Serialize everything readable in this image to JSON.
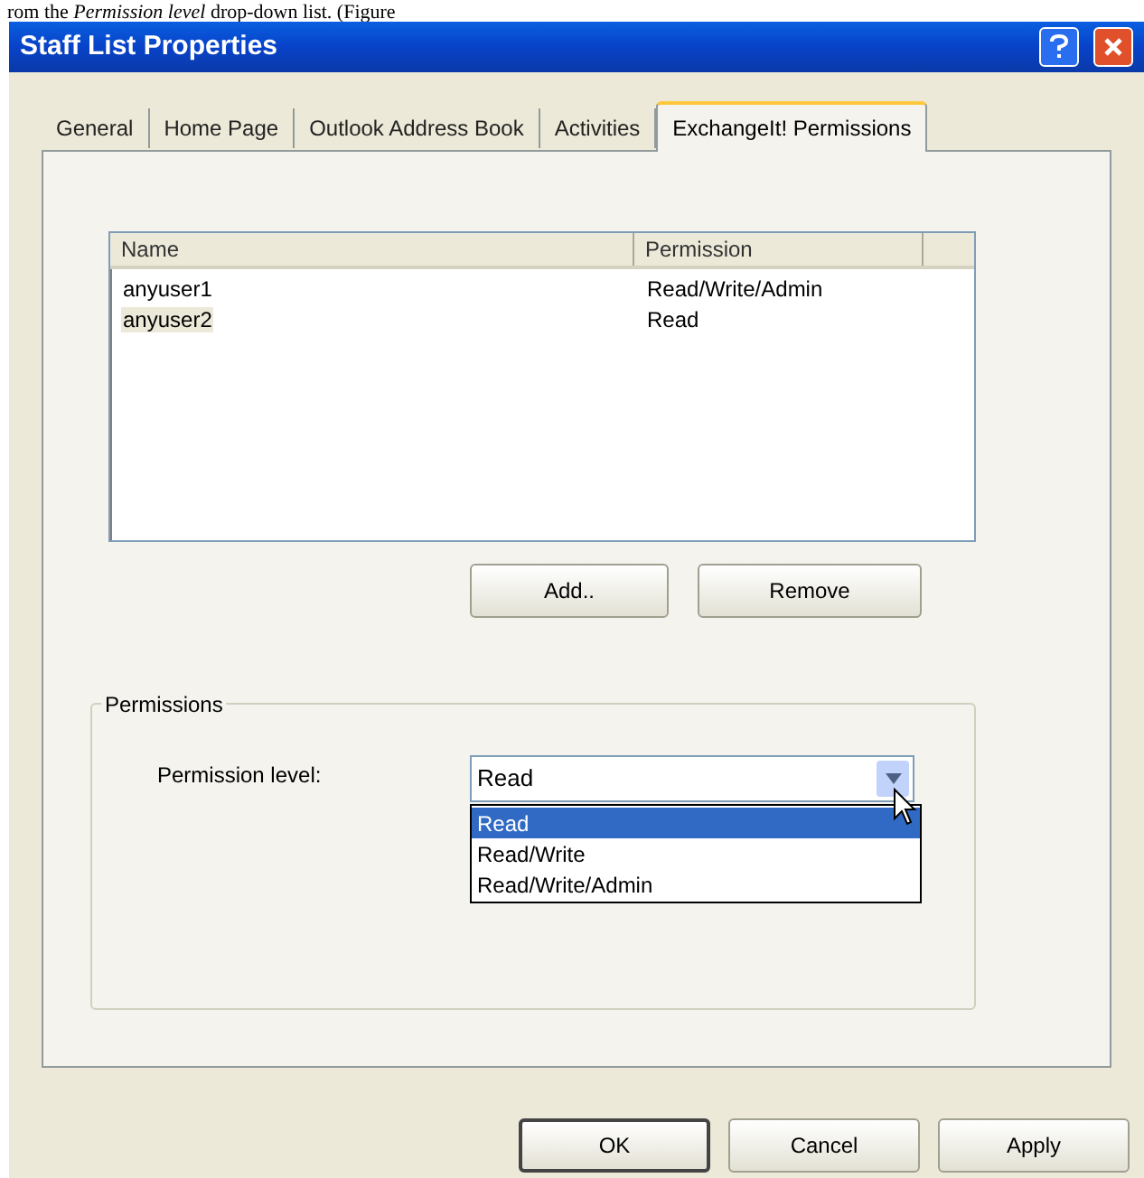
{
  "caption": "rom the *Permission level* drop-down list. (Figure",
  "window": {
    "title": "Staff List Properties"
  },
  "tabs": [
    {
      "label": "General",
      "selected": false
    },
    {
      "label": "Home Page",
      "selected": false
    },
    {
      "label": "Outlook Address Book",
      "selected": false
    },
    {
      "label": "Activities",
      "selected": false
    },
    {
      "label": "ExchangeIt! Permissions",
      "selected": true
    }
  ],
  "list": {
    "columns": [
      "Name",
      "Permission"
    ],
    "rows": [
      {
        "cells": [
          "anyuser1",
          "Read/Write/Admin"
        ],
        "selected": false
      },
      {
        "cells": [
          "anyuser2",
          "Read"
        ],
        "selected": true
      }
    ]
  },
  "list_buttons": [
    "Add..",
    "Remove"
  ],
  "permissions": {
    "title": "Permissions",
    "label": "Permission level:",
    "value": "Read",
    "options": [
      {
        "label": "Read",
        "selected": true
      },
      {
        "label": "Read/Write",
        "selected": false
      },
      {
        "label": "Read/Write/Admin",
        "selected": false
      }
    ]
  },
  "buttons": [
    {
      "label": "OK",
      "default": true
    },
    {
      "label": "Cancel",
      "default": false
    },
    {
      "label": "Apply",
      "default": false
    }
  ]
}
